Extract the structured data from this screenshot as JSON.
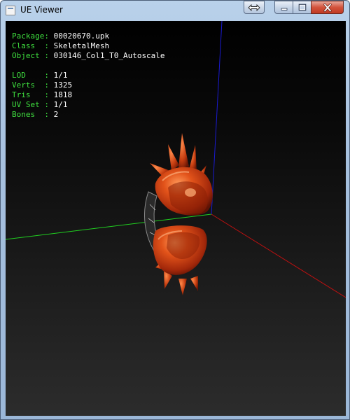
{
  "window": {
    "title": "UE Viewer",
    "icon": "app-icon",
    "controls": {
      "swap_icon": "⟺",
      "minimize_icon": "minimize-icon",
      "maximize_icon": "maximize-icon",
      "close_icon": "close-icon"
    }
  },
  "info": {
    "package": {
      "label": "Package:",
      "value": "00020670.upk"
    },
    "class": {
      "label": "Class  :",
      "value": "SkeletalMesh"
    },
    "object": {
      "label": "Object :",
      "value": "030146_Col1_T0_Autoscale"
    },
    "lod": {
      "label": "LOD    :",
      "value": "1/1"
    },
    "verts": {
      "label": "Verts  :",
      "value": "1325"
    },
    "tris": {
      "label": "Tris   :",
      "value": "1818"
    },
    "uvset": {
      "label": "UV Set :",
      "value": "1/1"
    },
    "bones": {
      "label": "Bones  :",
      "value": "2"
    }
  },
  "colors": {
    "label_green": "#3fe03f",
    "value_white": "#ffffff",
    "axis_x": "#c01010",
    "axis_y": "#20d020",
    "axis_z": "#1a1ad0",
    "mesh_orange": "#d8400e"
  }
}
